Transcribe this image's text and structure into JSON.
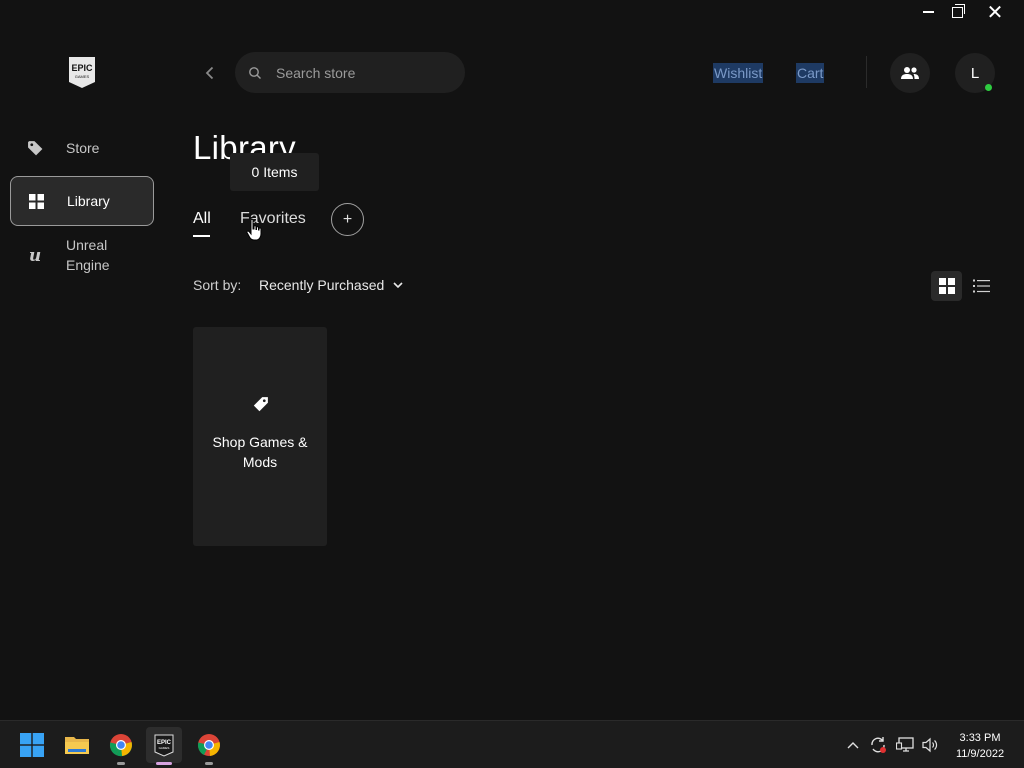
{
  "window": {
    "controls": [
      "minimize",
      "restore",
      "close"
    ]
  },
  "logo": {
    "line1": "EPIC",
    "line2": "GAMES"
  },
  "sidebar": {
    "items": [
      {
        "label": "Store",
        "icon": "tag-icon",
        "active": false
      },
      {
        "label": "Library",
        "icon": "grid-icon",
        "active": true
      },
      {
        "label": "Unreal Engine",
        "icon": "unreal-icon",
        "active": false
      }
    ]
  },
  "topbar": {
    "search_placeholder": "Search store",
    "wishlist": "Wishlist",
    "cart": "Cart",
    "avatar_initial": "L",
    "online_color": "#2ecc40"
  },
  "library": {
    "title": "Library",
    "tooltip": "0 Items",
    "tabs": [
      {
        "label": "All",
        "selected": true
      },
      {
        "label": "Favorites",
        "selected": false
      }
    ],
    "add_tab": "+",
    "sort_label": "Sort by:",
    "sort_value": "Recently Purchased",
    "view_mode": "grid",
    "shop_card": "Shop Games & Mods"
  },
  "taskbar": {
    "apps": [
      "windows-start",
      "file-explorer",
      "google-chrome",
      "epic-games-launcher",
      "google-chrome"
    ],
    "time": "3:33 PM",
    "date": "11/9/2022"
  },
  "colors": {
    "background": "#121212",
    "accent_link": "#7a99c7",
    "selected_bg": "#2a2a2a"
  }
}
